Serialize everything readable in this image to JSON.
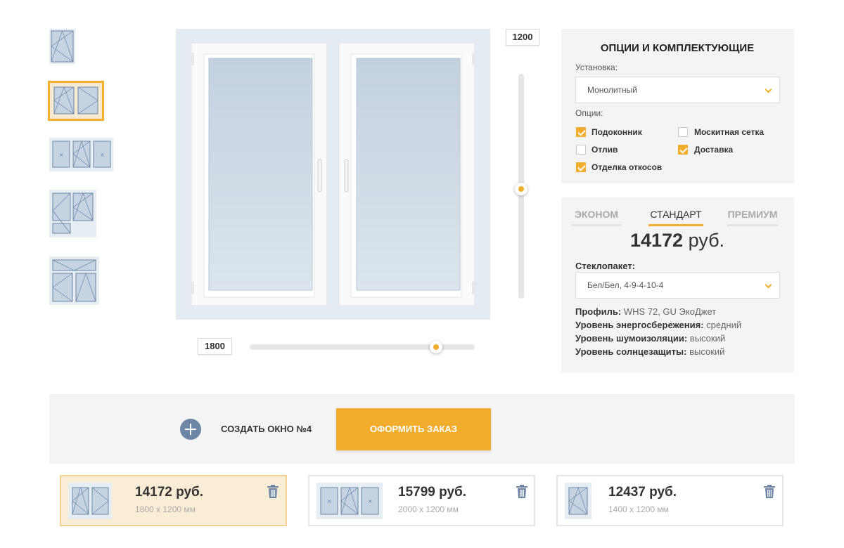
{
  "colors": {
    "accent": "#f2ad2c",
    "panel": "#f4f4f4",
    "glass": "#c5d3e2",
    "plus": "#6d86a6"
  },
  "window_types": [
    {
      "icon": "single-sash-window-icon",
      "selected": false
    },
    {
      "icon": "double-sash-window-icon",
      "selected": true
    },
    {
      "icon": "triple-sash-window-icon",
      "selected": false
    },
    {
      "icon": "balcony-door-window-icon",
      "selected": false
    },
    {
      "icon": "transom-window-icon",
      "selected": false
    }
  ],
  "dimensions": {
    "width": "1800",
    "height": "1200"
  },
  "options_panel": {
    "title": "ОПЦИИ И КОМПЛЕКТУЮЩИЕ",
    "installation_label": "Установка:",
    "installation_value": "Монолитный",
    "options_label": "Опции:",
    "options": [
      {
        "label": "Подоконник",
        "checked": true
      },
      {
        "label": "Москитная сетка",
        "checked": false
      },
      {
        "label": "Отлив",
        "checked": false
      },
      {
        "label": "Доставка",
        "checked": true
      },
      {
        "label": "Отделка откосов",
        "checked": true
      }
    ]
  },
  "price_panel": {
    "tabs": [
      {
        "label": "ЭКОНОМ",
        "active": false
      },
      {
        "label": "СТАНДАРТ",
        "active": true
      },
      {
        "label": "ПРЕМИУМ",
        "active": false
      }
    ],
    "price_value": "14172",
    "price_currency": "руб.",
    "glass_label": "Стеклопакет:",
    "glass_value": "Бел/Бел, 4-9-4-10-4",
    "specs": [
      {
        "label": "Профиль:",
        "value": "WHS 72, GU ЭкоДжет"
      },
      {
        "label": "Уровень энергосбережения:",
        "value": "средний"
      },
      {
        "label": "Уровень шумоизоляции:",
        "value": "высокий"
      },
      {
        "label": "Уровень солнцезащиты:",
        "value": "высокий"
      }
    ]
  },
  "actions": {
    "create_label": "СОЗДАТЬ ОКНО №4",
    "order_label": "ОФОРМИТЬ ЗАКАЗ"
  },
  "saved_windows": [
    {
      "price": "14172 руб.",
      "dims": "1800 x 1200 мм",
      "selected": true,
      "icon": "double-sash-window-icon"
    },
    {
      "price": "15799 руб.",
      "dims": "2000 x 1200 мм",
      "selected": false,
      "icon": "triple-sash-window-icon"
    },
    {
      "price": "12437 руб.",
      "dims": "1400 x 1200 мм",
      "selected": false,
      "icon": "single-sash-window-icon"
    }
  ]
}
